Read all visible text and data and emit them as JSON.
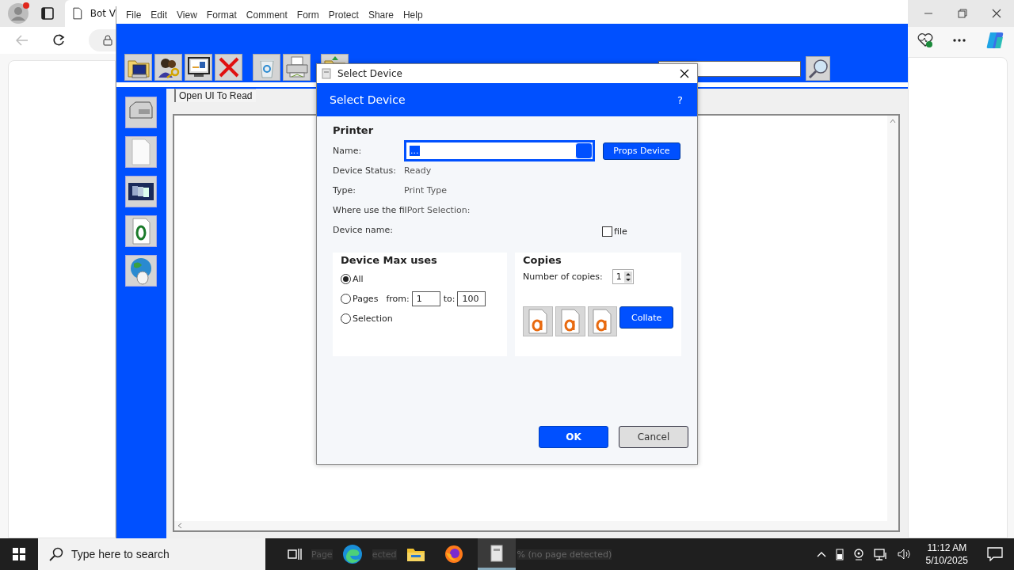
{
  "browser": {
    "tab_title": "Bot V"
  },
  "app": {
    "menu": [
      "File",
      "Edit",
      "View",
      "Format",
      "Comment",
      "Form",
      "Protect",
      "Share",
      "Help"
    ],
    "tab_label": "Open UI To Read"
  },
  "dialog": {
    "title": "Select Device",
    "header": "Select Device",
    "help": "?",
    "printer": {
      "heading": "Printer",
      "rows": [
        {
          "kind": "input",
          "label": "Name:",
          "value": "...",
          "button": "Props Device"
        },
        {
          "kind": "text",
          "label": "Device Status:",
          "value": "Ready"
        },
        {
          "kind": "text",
          "label": "Type:",
          "value": "Print Type"
        },
        {
          "kind": "text",
          "label": "Where use the fil",
          "value": "Port Selection:"
        },
        {
          "kind": "checkbox",
          "label": "Device name:",
          "check_label": "file",
          "checked": false
        }
      ]
    },
    "range": {
      "heading": "Device Max uses",
      "options": [
        {
          "label": "All",
          "selected": true
        },
        {
          "label": "Pages",
          "selected": false
        },
        {
          "label": "Selection",
          "selected": false
        }
      ],
      "from_label": "from:",
      "from": "1",
      "to_label": "to:",
      "to": "100"
    },
    "copies": {
      "heading": "Copies",
      "label": "Number of copies:",
      "value": "1",
      "collate": "Collate"
    },
    "buttons": [
      "OK",
      "Cancel"
    ]
  },
  "taskbar": {
    "search_placeholder": "Type here to search",
    "task_text_1": "Page",
    "task_text_2": "ected",
    "task_text_3": "% (no page detected)",
    "time": "11:12 AM",
    "date": "5/10/2025"
  }
}
